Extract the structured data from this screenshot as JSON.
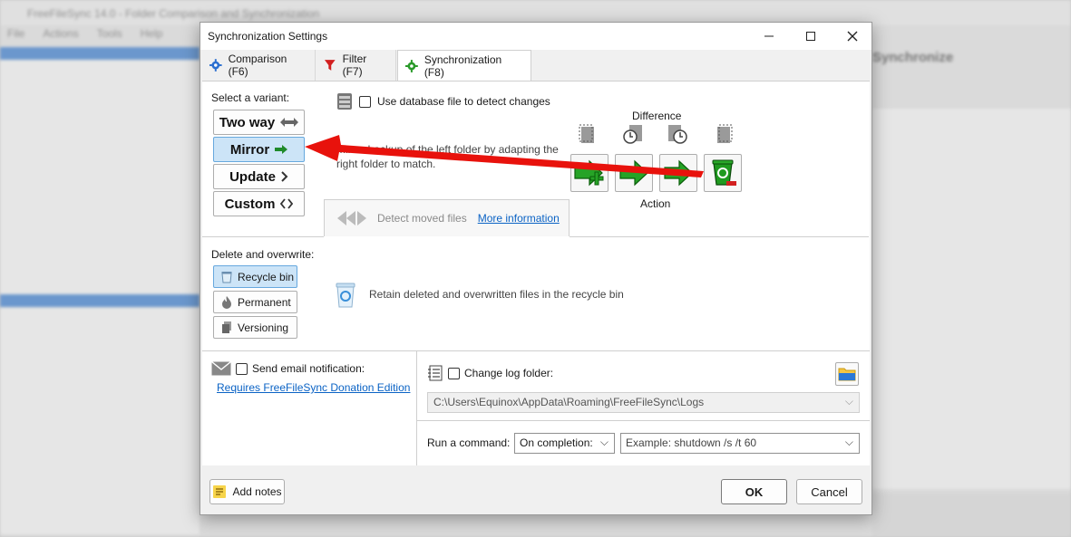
{
  "background": {
    "app_title": "FreeFileSync 14.0 - Folder Comparison and Synchronization",
    "menu": [
      "File",
      "Actions",
      "Tools",
      "Help"
    ],
    "sync_label": "Synchronize"
  },
  "dialog": {
    "title": "Synchronization Settings",
    "tabs": [
      {
        "label": "Comparison (F6)",
        "icon": "gear-icon"
      },
      {
        "label": "Filter (F7)",
        "icon": "funnel-icon"
      },
      {
        "label": "Synchronization (F8)",
        "icon": "gear-icon",
        "active": true
      }
    ]
  },
  "sync": {
    "select_variant_label": "Select a variant:",
    "variants": [
      {
        "label": "Two way",
        "icon": "two-way-arrow-icon"
      },
      {
        "label": "Mirror",
        "icon": "right-arrow-icon",
        "selected": true
      },
      {
        "label": "Update",
        "icon": "chevron-right-icon"
      },
      {
        "label": "Custom",
        "icon": "angle-brackets-icon"
      }
    ],
    "database_checkbox_label": "Use database file to detect changes",
    "description": "Mirror backup of the left folder by adapting the right folder to match.",
    "difference_label": "Difference",
    "action_label": "Action",
    "detect_moved_label": "Detect moved files",
    "more_info_link": "More information"
  },
  "delete": {
    "label": "Delete and overwrite:",
    "options": [
      {
        "label": "Recycle bin",
        "selected": true
      },
      {
        "label": "Permanent"
      },
      {
        "label": "Versioning"
      }
    ],
    "retain_text": "Retain deleted and overwritten files in the recycle bin"
  },
  "notify": {
    "email_label": "Send email notification:",
    "donation_link": "Requires FreeFileSync Donation Edition"
  },
  "log": {
    "change_log_label": "Change log folder:",
    "path": "C:\\Users\\Equinox\\AppData\\Roaming\\FreeFileSync\\Logs"
  },
  "command": {
    "label": "Run a command:",
    "when": "On completion:",
    "placeholder": "Example: shutdown /s /t 60"
  },
  "footer": {
    "notes": "Add notes",
    "ok": "OK",
    "cancel": "Cancel"
  },
  "colors": {
    "accent_selected": "#cce4f7",
    "link": "#0b63c5",
    "green": "#1f8a2a",
    "annotation_red": "#e8120c"
  }
}
